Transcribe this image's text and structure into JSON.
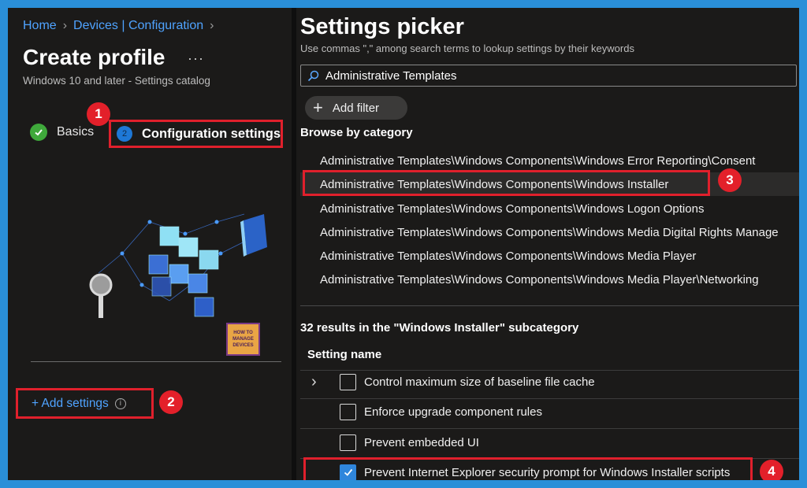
{
  "breadcrumb": {
    "home": "Home",
    "devices": "Devices | Configuration"
  },
  "profile": {
    "title": "Create profile",
    "more": "···",
    "subtitle": "Windows 10 and later - Settings catalog"
  },
  "steps": [
    {
      "label": "Basics",
      "status": "completed"
    },
    {
      "number": "2",
      "label": "Configuration settings",
      "status": "active"
    }
  ],
  "logo": {
    "line1": "HOW TO",
    "line2": "MANAGE",
    "line3": "DEVICES"
  },
  "add_settings": {
    "label": "+ Add settings",
    "info": "i"
  },
  "callouts": [
    "1",
    "2",
    "3",
    "4"
  ],
  "picker": {
    "title": "Settings picker",
    "hint": "Use commas \",\" among search terms to lookup settings by their keywords",
    "search_value": "Administrative Templates",
    "add_filter": "Add filter",
    "browse_heading": "Browse by category",
    "categories": [
      "Administrative Templates\\Windows Components\\Windows Error Reporting\\Consent",
      "Administrative Templates\\Windows Components\\Windows Installer",
      "Administrative Templates\\Windows Components\\Windows Logon Options",
      "Administrative Templates\\Windows Components\\Windows Media Digital Rights Manage",
      "Administrative Templates\\Windows Components\\Windows Media Player",
      "Administrative Templates\\Windows Components\\Windows Media Player\\Networking"
    ],
    "selected_category": "Administrative Templates\\Windows Components\\Windows Installer",
    "results_heading": "32 results in the \"Windows Installer\" subcategory",
    "column_header": "Setting name",
    "settings": [
      {
        "label": "Control maximum size of baseline file cache",
        "checked": false,
        "expandable": true
      },
      {
        "label": "Enforce upgrade component rules",
        "checked": false,
        "expandable": false
      },
      {
        "label": "Prevent embedded UI",
        "checked": false,
        "expandable": false
      },
      {
        "label": "Prevent Internet Explorer security prompt for Windows Installer scripts",
        "checked": true,
        "expandable": false
      }
    ]
  },
  "colors": {
    "background": "#1b1a19",
    "link": "#4fa3ff",
    "highlight_box": "#e0202c",
    "check_green": "#3fa93b",
    "checkbox_blue": "#2f86dc",
    "frame_border": "#2a8fd8"
  }
}
